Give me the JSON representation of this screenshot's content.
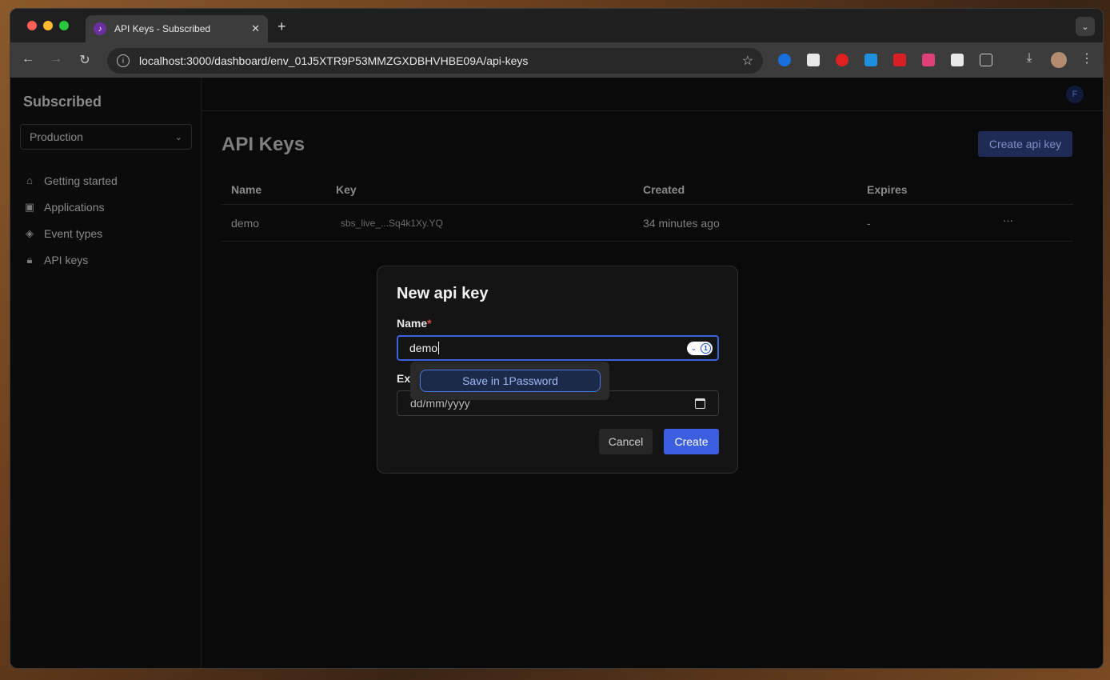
{
  "browser": {
    "tab_title": "API Keys - Subscribed",
    "new_tab": "+",
    "url": "localhost:3000/dashboard/env_01J5XTR9P53MMZGXDBHVHBE09A/api-keys",
    "extension_colors": [
      "#1a6fe0",
      "#e8e8e8",
      "#e02020",
      "#1e90e0",
      "#d81f26",
      "#e0407a",
      "#e8e8e8"
    ]
  },
  "sidebar": {
    "brand": "Subscribed",
    "environment": "Production",
    "items": [
      {
        "label": "Getting started",
        "icon": "home-icon"
      },
      {
        "label": "Applications",
        "icon": "applications-icon"
      },
      {
        "label": "Event types",
        "icon": "layers-icon"
      },
      {
        "label": "API keys",
        "icon": "lock-icon"
      }
    ]
  },
  "header": {
    "avatar_initial": "F"
  },
  "main": {
    "title": "API Keys",
    "create_button": "Create api key",
    "table": {
      "headers": [
        "Name",
        "Key",
        "Created",
        "Expires"
      ],
      "rows": [
        {
          "name": "demo",
          "key": "sbs_live_...Sq4k1Xy.YQ",
          "created": "34 minutes ago",
          "expires": "-",
          "actions": "···"
        }
      ]
    }
  },
  "modal": {
    "title": "New api key",
    "name_label": "Name",
    "required_marker": "*",
    "name_value": "demo",
    "expires_label_partial": "Ex",
    "date_placeholder": "dd/mm/yyyy",
    "onepassword_save": "Save in 1Password",
    "cancel": "Cancel",
    "create": "Create"
  },
  "colors": {
    "primary": "#3b5fde",
    "focus": "#3b63e0",
    "required": "#e04a4a"
  }
}
